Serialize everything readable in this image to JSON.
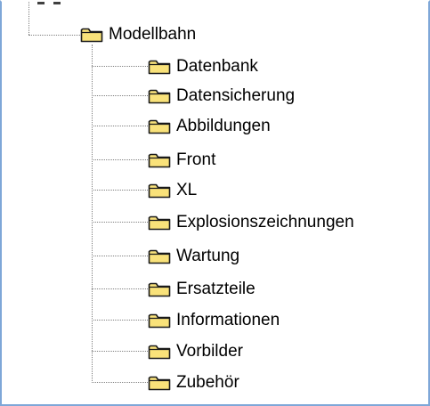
{
  "tree": {
    "root": {
      "label": "Modellbahn",
      "icon": "folder-icon"
    },
    "children": [
      {
        "label": "Datenbank",
        "icon": "folder-icon"
      },
      {
        "label": "Datensicherung",
        "icon": "folder-icon"
      },
      {
        "label": "Abbildungen",
        "icon": "folder-icon"
      },
      {
        "label": "Front",
        "icon": "folder-icon"
      },
      {
        "label": "XL",
        "icon": "folder-icon"
      },
      {
        "label": "Explosionszeichnungen",
        "icon": "folder-icon"
      },
      {
        "label": "Wartung",
        "icon": "folder-icon"
      },
      {
        "label": "Ersatzteile",
        "icon": "folder-icon"
      },
      {
        "label": "Informationen",
        "icon": "folder-icon"
      },
      {
        "label": "Vorbilder",
        "icon": "folder-icon"
      },
      {
        "label": "Zubehör",
        "icon": "folder-icon"
      }
    ]
  },
  "colors": {
    "folder_fill": "#f9e27a",
    "folder_stroke": "#1a1a1a",
    "frame_border": "#7ea7d8",
    "connector": "#808080"
  }
}
